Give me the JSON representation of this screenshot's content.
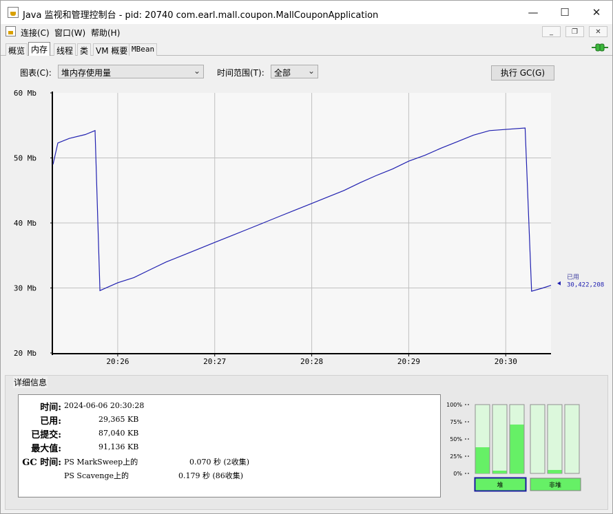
{
  "window": {
    "title": "Java 监视和管理控制台 - pid: 20740 com.earl.mall.coupon.MallCouponApplication",
    "minimize_icon": "minimize-icon",
    "maximize_icon": "maximize-icon",
    "close_icon": "close-icon"
  },
  "menu": {
    "items": [
      "连接(C)",
      "窗口(W)",
      "帮助(H)"
    ]
  },
  "tabs": {
    "items": [
      "概览",
      "内存",
      "线程",
      "类",
      "VM 概要",
      "MBean"
    ],
    "selected": "内存"
  },
  "controls": {
    "chart_label": "图表(C):",
    "chart_value": "堆内存使用量",
    "range_label": "时间范围(T):",
    "range_value": "全部",
    "gc_button": "执行 GC(G)"
  },
  "chart_data": {
    "type": "line",
    "x_ticks": [
      "20:26",
      "20:27",
      "20:28",
      "20:29",
      "20:30"
    ],
    "y_ticks": [
      "20 Mb",
      "30 Mb",
      "40 Mb",
      "50 Mb",
      "60 Mb"
    ],
    "ylim": [
      20,
      60
    ],
    "xlim": [
      "20:25:20",
      "20:30:28"
    ],
    "grid": true,
    "series": [
      {
        "name": "已用",
        "color": "#2020b0",
        "points": [
          [
            "20:25:20",
            49.0
          ],
          [
            "20:25:23",
            52.3
          ],
          [
            "20:25:30",
            53.0
          ],
          [
            "20:25:40",
            53.6
          ],
          [
            "20:25:46",
            54.2
          ],
          [
            "20:25:49",
            29.6
          ],
          [
            "20:26:00",
            30.8
          ],
          [
            "20:26:10",
            31.6
          ],
          [
            "20:26:20",
            32.8
          ],
          [
            "20:26:30",
            34.0
          ],
          [
            "20:26:40",
            35.0
          ],
          [
            "20:26:50",
            36.0
          ],
          [
            "20:27:00",
            37.0
          ],
          [
            "20:27:10",
            38.0
          ],
          [
            "20:27:20",
            39.0
          ],
          [
            "20:27:30",
            40.0
          ],
          [
            "20:27:40",
            41.0
          ],
          [
            "20:27:50",
            42.0
          ],
          [
            "20:28:00",
            43.0
          ],
          [
            "20:28:10",
            44.0
          ],
          [
            "20:28:20",
            45.0
          ],
          [
            "20:28:30",
            46.2
          ],
          [
            "20:28:40",
            47.3
          ],
          [
            "20:28:50",
            48.3
          ],
          [
            "20:29:00",
            49.5
          ],
          [
            "20:29:10",
            50.4
          ],
          [
            "20:29:20",
            51.5
          ],
          [
            "20:29:30",
            52.5
          ],
          [
            "20:29:40",
            53.5
          ],
          [
            "20:29:50",
            54.2
          ],
          [
            "20:30:12",
            54.6
          ],
          [
            "20:30:16",
            29.5
          ],
          [
            "20:30:23",
            30.0
          ],
          [
            "20:30:28",
            30.4
          ]
        ]
      }
    ],
    "legend": {
      "label": "已用",
      "value": "30,422,208"
    }
  },
  "details": {
    "title": "详细信息",
    "time_label": "时间:",
    "time_value": "2024-06-06 20:30:28",
    "used_label": "已用:",
    "used_value": "29,365 KB",
    "committed_label": "已提交:",
    "committed_value": "87,040 KB",
    "max_label": "最大值:",
    "max_value": "91,136 KB",
    "gc_label": "GC 时间:",
    "gc_marksweep_name": "PS MarkSweep上的",
    "gc_marksweep_value": "0.070 秒 (2收集)",
    "gc_scavenge_name": "PS Scavenge上的",
    "gc_scavenge_value": "0.179 秒 (86收集)"
  },
  "pools": {
    "y_ticks": [
      "100%",
      "75%",
      "50%",
      "25%",
      "0%"
    ],
    "heap_label": "堆",
    "nonheap_label": "非堆",
    "heap_bars": [
      0.38,
      0.04,
      0.71
    ],
    "nonheap_bars": [
      0.0,
      0.05,
      0.0
    ],
    "bar_fill": "#66f066",
    "bar_bg": "#dcf8dc"
  }
}
